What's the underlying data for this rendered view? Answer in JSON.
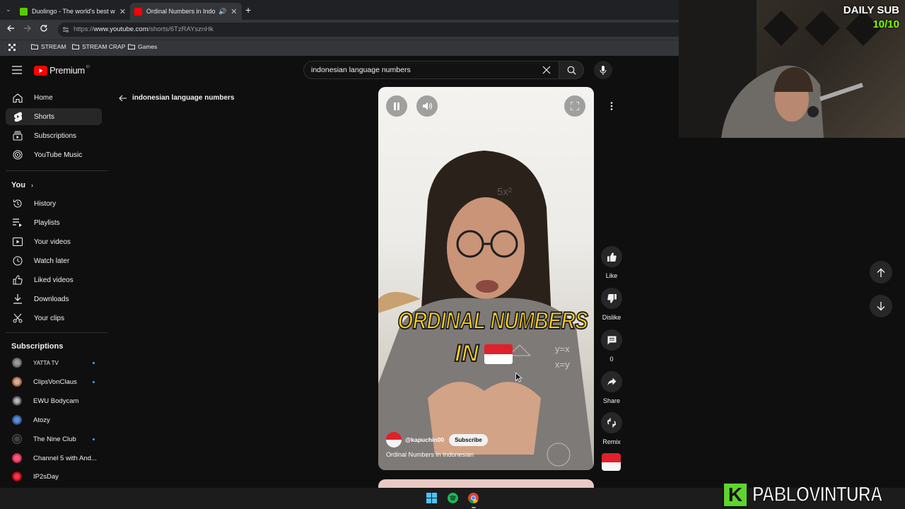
{
  "browser": {
    "tabs": [
      {
        "title": "Duolingo - The world's best wa",
        "favicon_color": "#58cc02"
      },
      {
        "title": "Ordinal Numbers in Indone",
        "favicon_color": "#ff0000"
      }
    ],
    "new_tab": "+",
    "url_prefix": "https://",
    "url_domain": "www.youtube.com",
    "url_path": "/shorts/6TzRAYsznHk",
    "bookmarks": [
      "STREAM",
      "STREAM CRAP",
      "Games"
    ]
  },
  "youtube": {
    "logo_text": "Premium",
    "logo_sup": "ID",
    "search_value": "indonesian language numbers",
    "back_label": "indonesian language numbers",
    "sidebar": {
      "main": [
        "Home",
        "Shorts",
        "Subscriptions",
        "YouTube Music"
      ],
      "you_header": "You",
      "you": [
        "History",
        "Playlists",
        "Your videos",
        "Watch later",
        "Liked videos",
        "Downloads",
        "Your clips"
      ],
      "subs_header": "Subscriptions",
      "subs": [
        {
          "name": "YATTA TV",
          "dot": true
        },
        {
          "name": "ClipsVonClaus",
          "dot": true
        },
        {
          "name": "EWU Bodycam",
          "dot": false
        },
        {
          "name": "Atozy",
          "dot": false
        },
        {
          "name": "The Nine Club",
          "dot": true
        },
        {
          "name": "Channel 5 with And...",
          "dot": false
        },
        {
          "name": "IP2sDay",
          "dot": false
        }
      ]
    },
    "short": {
      "overlay_line1": "ORDINAL NUMBERS",
      "overlay_line2": "IN",
      "channel": "@kapuchin00",
      "subscribe": "Subscribe",
      "title": "Ordinal Numbers in Indonesian"
    },
    "actions": {
      "like": "Like",
      "dislike": "Dislike",
      "comments": "0",
      "share": "Share",
      "remix": "Remix"
    }
  },
  "stream_overlay": {
    "daily_sub_label": "DAILY SUB",
    "daily_sub_count": "10/10",
    "brand_letter": "K",
    "brand_name": "PABLOVINTURA"
  },
  "colors": {
    "accent": "#ff0000",
    "dot": "#3ea6ff",
    "sub_counter": "#7cfc00"
  }
}
